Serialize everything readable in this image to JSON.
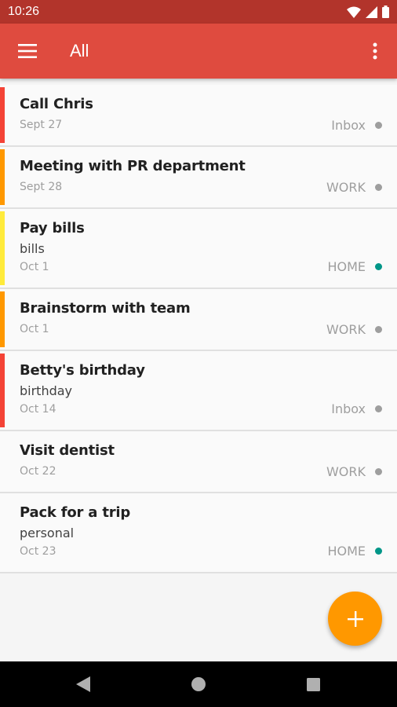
{
  "status_bar": {
    "time": "10:26"
  },
  "app_bar": {
    "title": "All",
    "menu_icon": "hamburger-menu-icon",
    "more_icon": "more-vert-icon"
  },
  "colors": {
    "app_bar": "#df4b3f",
    "status_bar": "#b2342b",
    "fab": "#ff9800",
    "priority_red": "#f44336",
    "priority_orange": "#ff9800",
    "priority_yellow": "#ffeb3b",
    "project_gray": "#9e9e9e",
    "project_teal": "#009688"
  },
  "tasks": [
    {
      "title": "Call Chris",
      "note": "",
      "date": "Sept 27",
      "project": "Inbox",
      "priority_color": "#f44336",
      "dot_color": "#9e9e9e"
    },
    {
      "title": "Meeting with PR department",
      "note": "",
      "date": "Sept 28",
      "project": "WORK",
      "priority_color": "#ff9800",
      "dot_color": "#9e9e9e"
    },
    {
      "title": "Pay bills",
      "note": "bills",
      "date": "Oct 1",
      "project": "HOME",
      "priority_color": "#ffeb3b",
      "dot_color": "#009688"
    },
    {
      "title": "Brainstorm with team",
      "note": "",
      "date": "Oct 1",
      "project": "WORK",
      "priority_color": "#ff9800",
      "dot_color": "#9e9e9e"
    },
    {
      "title": "Betty's birthday",
      "note": "birthday",
      "date": "Oct 14",
      "project": "Inbox",
      "priority_color": "#f44336",
      "dot_color": "#9e9e9e"
    },
    {
      "title": "Visit dentist",
      "note": "",
      "date": "Oct 22",
      "project": "WORK",
      "priority_color": "",
      "dot_color": "#9e9e9e"
    },
    {
      "title": "Pack for a trip",
      "note": "personal",
      "date": "Oct 23",
      "project": "HOME",
      "priority_color": "",
      "dot_color": "#009688"
    }
  ],
  "fab": {
    "icon": "plus-icon"
  },
  "nav_bar": {
    "back_icon": "back-triangle-icon",
    "home_icon": "home-circle-icon",
    "recents_icon": "recents-square-icon"
  }
}
